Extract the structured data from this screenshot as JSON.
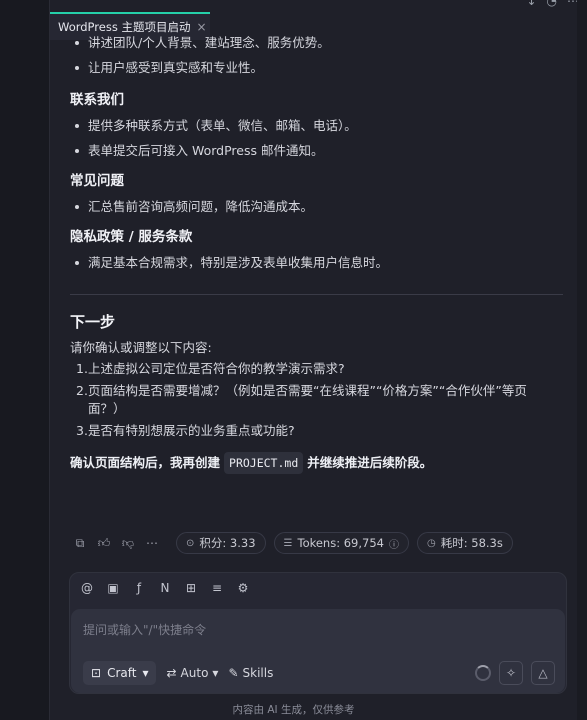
{
  "tab": {
    "title": "WordPress 主题项目启动",
    "close": "×"
  },
  "sections": {
    "top_bullets": [
      "讲述团队/个人背景、建站理念、服务优势。",
      "让用户感受到真实感和专业性。"
    ],
    "contact": {
      "title": "联系我们",
      "bullets": [
        "提供多种联系方式（表单、微信、邮箱、电话）。",
        "表单提交后可接入 WordPress 邮件通知。"
      ]
    },
    "faq": {
      "title": "常见问题",
      "bullets": [
        "汇总售前咨询高频问题，降低沟通成本。"
      ]
    },
    "privacy": {
      "title": "隐私政策 / 服务条款",
      "bullets": [
        "满足基本合规需求，特别是涉及表单收集用户信息时。"
      ]
    }
  },
  "next_steps": {
    "title": "下一步",
    "intro": "请你确认或调整以下内容:",
    "items": [
      {
        "num": "1.",
        "text": "上述虚拟公司定位是否符合你的教学演示需求?"
      },
      {
        "num": "2.",
        "text": "页面结构是否需要增减？（例如是否需要“在线课程”“价格方案”“合作伙伴”等页面？）"
      },
      {
        "num": "3.",
        "text": "是否有特别想展示的业务重点或功能?"
      }
    ],
    "confirm_before": "确认页面结构后，我再创建",
    "confirm_code": "PROJECT.md",
    "confirm_after": "并继续推进后续阶段。"
  },
  "meta": {
    "points_label": "积分: 3.33",
    "tokens_label": "Tokens: 69,754",
    "time_label": "耗时: 58.3s"
  },
  "composer": {
    "placeholder": "提问或输入\"/\"快捷命令",
    "mode": "Craft",
    "model": "Auto",
    "skills": "Skills"
  },
  "footer": "内容由 AI 生成，仅供参考"
}
